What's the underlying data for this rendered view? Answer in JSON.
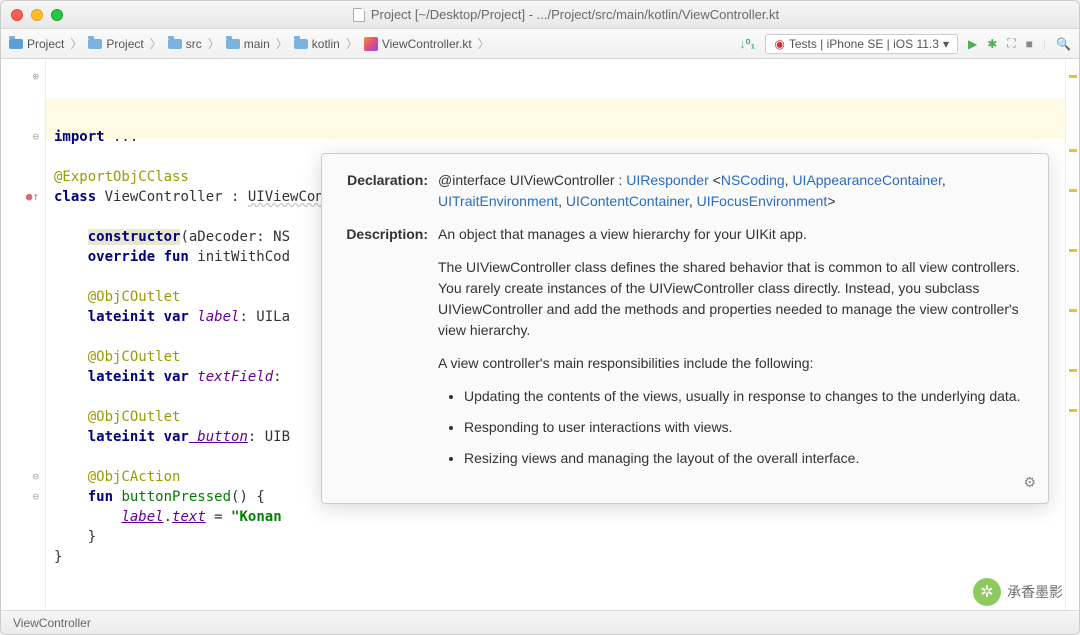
{
  "title": "Project [~/Desktop/Project] - .../Project/src/main/kotlin/ViewController.kt",
  "breadcrumbs": [
    "Project",
    "Project",
    "src",
    "main",
    "kotlin",
    "ViewController.kt"
  ],
  "run_config": "Tests | iPhone SE | iOS 11.3",
  "code": {
    "l1_kw": "import",
    "l1_rest": " ...",
    "l3": "@ExportObjCClass",
    "l4_kw": "class",
    "l4_name": " ViewController ",
    "l4_colon": ": ",
    "l4_super": "UIViewController",
    "l4_brace": " {",
    "l6_ctor": "constructor",
    "l6_rest": "(aDecoder: NS",
    "l7_kw": "override fun",
    "l7_name": " initWithCod",
    "l9": "@ObjCOutlet",
    "l10_kw": "lateinit var",
    "l10_id": " label",
    "l10_rest": ": UILa",
    "l12": "@ObjCOutlet",
    "l13_kw": "lateinit var",
    "l13_id": " textField",
    "l13_rest": ":",
    "l15": "@ObjCOutlet",
    "l16_kw": "lateinit var",
    "l16_id": " button",
    "l16_rest": ": UIB",
    "l18": "@ObjCAction",
    "l19_kw": "fun",
    "l19_fn": " buttonPressed",
    "l19_rest": "() {",
    "l20_a": "label",
    "l20_dot": ".",
    "l20_b": "text",
    "l20_eq": " = ",
    "l20_str": "\"Konan",
    "l21": "    }",
    "l22": "}"
  },
  "doc": {
    "decl_label": "Declaration:",
    "decl_prefix": "@interface UIViewController : ",
    "decl_links": [
      "UIResponder",
      "NSCoding",
      "UIAppearanceContainer",
      "UITraitEnvironment",
      "UIContentContainer",
      "UIFocusEnvironment"
    ],
    "desc_label": "Description:",
    "p1": "An object that manages a view hierarchy for your UIKit app.",
    "p2": "The UIViewController class defines the shared behavior that is common to all view controllers. You rarely create instances of the UIViewController class directly. Instead, you subclass UIViewController and add the methods and properties needed to manage the view controller's view hierarchy.",
    "p3": "A view controller's main responsibilities include the following:",
    "bullets": [
      "Updating the contents of the views, usually in response to changes to the underlying data.",
      "Responding to user interactions with views.",
      "Resizing views and managing the layout of the overall interface."
    ]
  },
  "status": "ViewController",
  "watermark": "承香墨影"
}
